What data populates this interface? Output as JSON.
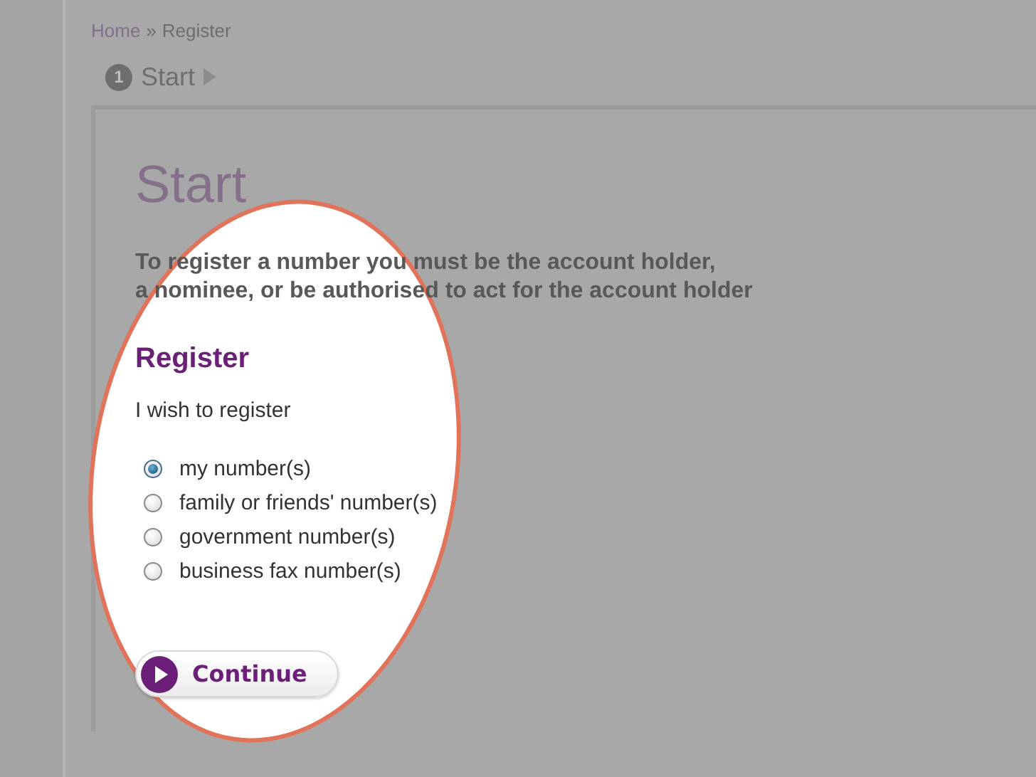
{
  "breadcrumb": [
    {
      "kind": "link",
      "label": "Home"
    },
    {
      "kind": "separator",
      "label": "»"
    },
    {
      "kind": "current",
      "label": "Register"
    }
  ],
  "steps": [
    {
      "number": "1",
      "label": "Start",
      "selected": true
    }
  ],
  "title": "Start",
  "intro": "To register a number you must be the account holder,\na nominee, or be authorised to act for the account holder",
  "section_title": "Register",
  "prompt": "I wish to register",
  "options": [
    {
      "label": "my number(s)",
      "selected": true
    },
    {
      "label": "family or friends' number(s)",
      "selected": false
    },
    {
      "label": "government number(s)",
      "selected": false
    },
    {
      "label": "business fax number(s)",
      "selected": false
    }
  ],
  "continue_button": {
    "label": "Continue"
  }
}
